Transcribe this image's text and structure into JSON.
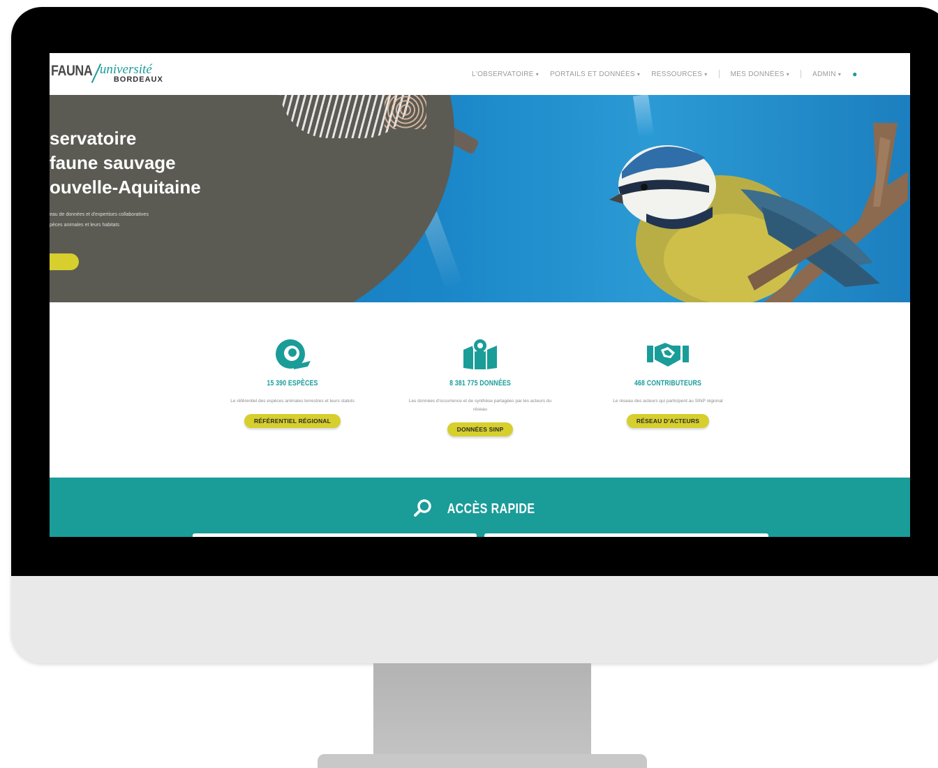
{
  "logo": {
    "fauna": "FAUNA",
    "universite": "université",
    "bordeaux": "BORDEAUX"
  },
  "nav": {
    "items": [
      {
        "label": "L'OBSERVATOIRE"
      },
      {
        "label": "PORTAILS ET DONNÉES"
      },
      {
        "label": "RESSOURCES"
      },
      {
        "label": "MES DONNÉES"
      },
      {
        "label": "ADMIN"
      }
    ]
  },
  "hero": {
    "title_line1": "servatoire",
    "title_line2": "faune sauvage",
    "title_line3": "ouvelle-Aquitaine",
    "desc_line1": "eau de données et d'expertises collaboratives",
    "desc_line2": "pèces animales et leurs habitats"
  },
  "stats": [
    {
      "title": "15 390 ESPÈCES",
      "desc": "Le référentiel des espèces animales terrestres et leurs statuts",
      "button": "RÉFÉRENTIEL RÉGIONAL"
    },
    {
      "title": "8 381 775 DONNÉES",
      "desc": "Les données d'occurrence et de synthèse partagées par les acteurs du réseau",
      "button": "DONNÉES SINP"
    },
    {
      "title": "468 CONTRIBUTEURS",
      "desc": "Le réseau des acteurs qui participent au SINP régional",
      "button": "RÉSEAU D'ACTEURS"
    }
  ],
  "quick_access": {
    "title": "ACCÈS RAPIDE"
  },
  "colors": {
    "teal": "#1a9c99",
    "yellow": "#d6cf2d",
    "hero_dark": "#5b5b54",
    "sky": "#1a86c8"
  }
}
